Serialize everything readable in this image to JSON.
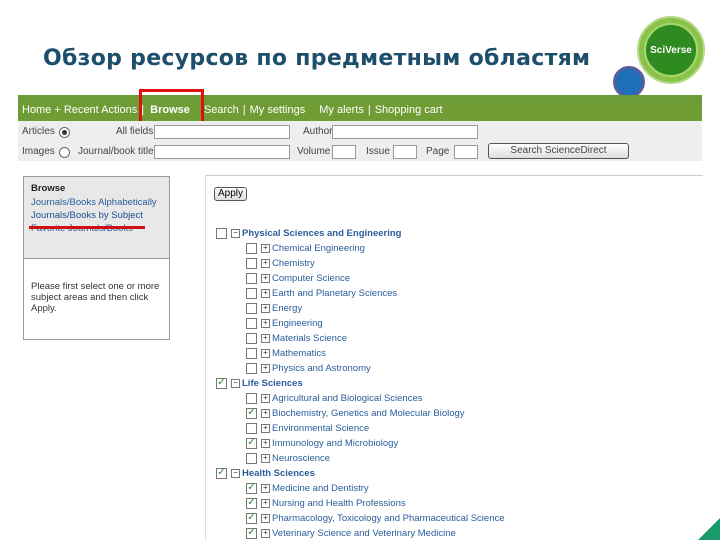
{
  "slide": {
    "title": "Обзор ресурсов по предметным областям",
    "logo_text": "SciVerse"
  },
  "nav": {
    "items": [
      "Home + Recent Actions",
      "Browse",
      "Search",
      "My settings",
      "My alerts",
      "Shopping cart"
    ],
    "active": "Browse",
    "highlight_color": "#e01010"
  },
  "search": {
    "articles": "Articles",
    "images": "Images",
    "all_fields": "All fields",
    "journal_title": "Journal/book title",
    "author": "Author",
    "volume": "Volume",
    "issue": "Issue",
    "page": "Page",
    "button": "Search ScienceDirect",
    "selected": "Articles"
  },
  "sidebar": {
    "heading": "Browse",
    "links": [
      "Journals/Books Alphabetically",
      "Journals/Books by Subject",
      "Favorite Journals/Books"
    ],
    "active": "Journals/Books by Subject",
    "message": "Please first select one or more subject areas and then click Apply."
  },
  "main": {
    "apply": "Apply",
    "tree": [
      {
        "label": "Physical Sciences and Engineering",
        "group": true,
        "checked": false
      },
      {
        "label": "Chemical Engineering",
        "checked": false
      },
      {
        "label": "Chemistry",
        "checked": false
      },
      {
        "label": "Computer Science",
        "checked": false
      },
      {
        "label": "Earth and Planetary Sciences",
        "checked": false
      },
      {
        "label": "Energy",
        "checked": false
      },
      {
        "label": "Engineering",
        "checked": false
      },
      {
        "label": "Materials Science",
        "checked": false
      },
      {
        "label": "Mathematics",
        "checked": false
      },
      {
        "label": "Physics and Astronomy",
        "checked": false
      },
      {
        "label": "Life Sciences",
        "group": true,
        "checked": true
      },
      {
        "label": "Agricultural and Biological Sciences",
        "checked": false
      },
      {
        "label": "Biochemistry, Genetics and Molecular Biology",
        "checked": true
      },
      {
        "label": "Environmental Science",
        "checked": false
      },
      {
        "label": "Immunology and Microbiology",
        "checked": true
      },
      {
        "label": "Neuroscience",
        "checked": false
      },
      {
        "label": "Health Sciences",
        "group": true,
        "checked": true
      },
      {
        "label": "Medicine and Dentistry",
        "checked": true
      },
      {
        "label": "Nursing and Health Professions",
        "checked": true
      },
      {
        "label": "Pharmacology, Toxicology and Pharmaceutical Science",
        "checked": true
      },
      {
        "label": "Veterinary Science and Veterinary Medicine",
        "checked": true
      }
    ]
  }
}
